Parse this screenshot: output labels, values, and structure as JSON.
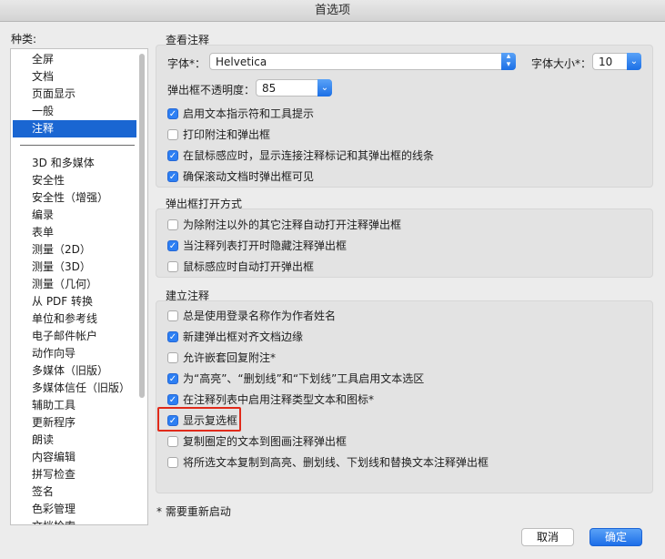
{
  "window": {
    "title": "首选项"
  },
  "categories": {
    "label": "种类:",
    "top_items": [
      "全屏",
      "文档",
      "页面显示",
      "一般",
      "注释"
    ],
    "selected": "注释",
    "bottom_items": [
      "3D 和多媒体",
      "安全性",
      "安全性（增强）",
      "编录",
      "表单",
      "测量（2D）",
      "测量（3D）",
      "测量（几何）",
      "从 PDF 转换",
      "单位和参考线",
      "电子邮件帐户",
      "动作向导",
      "多媒体（旧版）",
      "多媒体信任（旧版）",
      "辅助工具",
      "更新程序",
      "朗读",
      "内容编辑",
      "拼写检查",
      "签名",
      "色彩管理",
      "文档检索"
    ]
  },
  "view_comments": {
    "title": "查看注释",
    "font_label": "字体*：",
    "font_value": "Helvetica",
    "font_size_label": "字体大小*：",
    "font_size_value": "10",
    "opacity_label": "弹出框不透明度：",
    "opacity_value": "85",
    "options": [
      {
        "label": "启用文本指示符和工具提示",
        "checked": true
      },
      {
        "label": "打印附注和弹出框",
        "checked": false
      },
      {
        "label": "在鼠标感应时，显示连接注释标记和其弹出框的线条",
        "checked": true
      },
      {
        "label": "确保滚动文档时弹出框可见",
        "checked": true
      }
    ]
  },
  "popup_behavior": {
    "title": "弹出框打开方式",
    "options": [
      {
        "label": "为除附注以外的其它注释自动打开注释弹出框",
        "checked": false
      },
      {
        "label": "当注释列表打开时隐藏注释弹出框",
        "checked": true
      },
      {
        "label": "鼠标感应时自动打开弹出框",
        "checked": false
      }
    ]
  },
  "making_comments": {
    "title": "建立注释",
    "options": [
      {
        "label": "总是使用登录名称作为作者姓名",
        "checked": false
      },
      {
        "label": "新建弹出框对齐文档边缘",
        "checked": true
      },
      {
        "label": "允许嵌套回复附注*",
        "checked": false
      },
      {
        "label": "为“高亮”、“删划线”和“下划线”工具启用文本选区",
        "checked": true
      },
      {
        "label": "在注释列表中启用注释类型文本和图标*",
        "checked": true
      },
      {
        "label": "显示复选框",
        "checked": true
      },
      {
        "label": "复制圈定的文本到图画注释弹出框",
        "checked": false
      },
      {
        "label": "将所选文本复制到高亮、删划线、下划线和替换文本注释弹出框",
        "checked": false
      }
    ]
  },
  "footer": {
    "note": "* 需要重新启动",
    "cancel_label": "取消",
    "ok_label": "确定"
  },
  "colors": {
    "accent": "#1a66d2",
    "highlight_border": "#e02a1a"
  }
}
